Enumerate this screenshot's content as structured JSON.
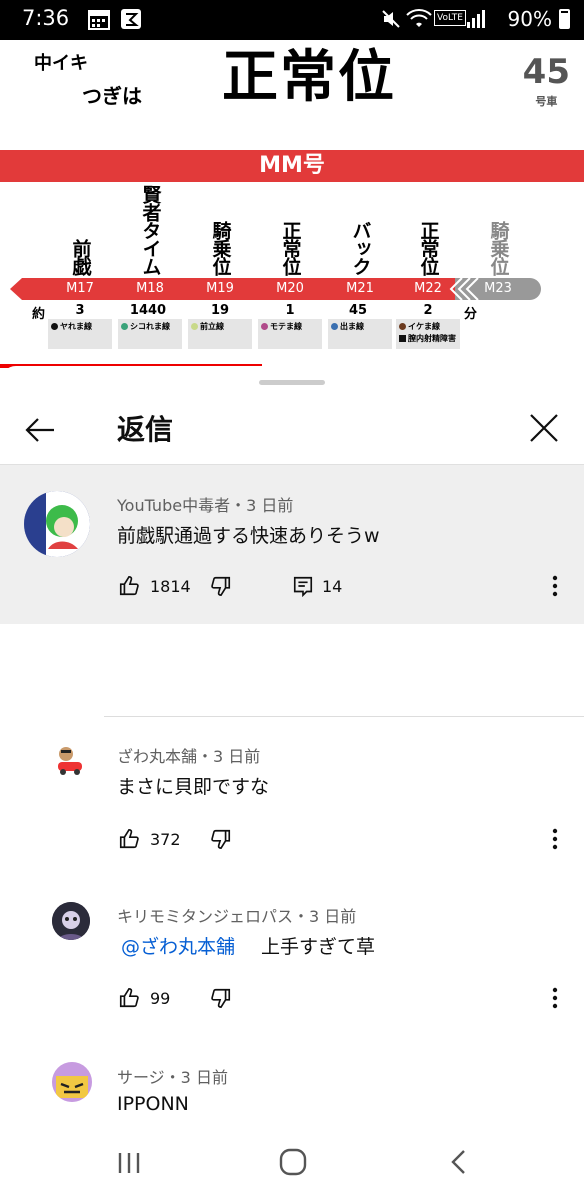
{
  "status_bar": {
    "time": "7:36",
    "battery": "90%",
    "volte": "VoLTE"
  },
  "board": {
    "service_type": "中イキ",
    "next_label": "つぎは",
    "next_station": "正常位",
    "line_name": "MM号",
    "car_number": "45",
    "car_label": "号車",
    "approx_label": "約",
    "minutes_label": "分",
    "stations": [
      {
        "name": "前戯",
        "code": "M17",
        "minutes": "3",
        "line": "ヤれま線",
        "line_color": "#111111",
        "extra": ""
      },
      {
        "name": "賢者タイム",
        "code": "M18",
        "minutes": "1440",
        "line": "シコれま線",
        "line_color": "#3aa37a",
        "extra": ""
      },
      {
        "name": "騎乗位",
        "code": "M19",
        "minutes": "19",
        "line": "前立線",
        "line_color": "#c8d98a",
        "extra": ""
      },
      {
        "name": "正常位",
        "code": "M20",
        "minutes": "1",
        "line": "モテま線",
        "line_color": "#b04a8a",
        "extra": ""
      },
      {
        "name": "バック",
        "code": "M21",
        "minutes": "45",
        "line": "出ま線",
        "line_color": "#3a6fb0",
        "extra": ""
      },
      {
        "name": "正常位",
        "code": "M22",
        "minutes": "2",
        "line": "イケま線",
        "line_color": "#6b3a1e",
        "extra": "膣内射精障害"
      },
      {
        "name": "騎乗位",
        "code": "M23",
        "minutes": "",
        "line": "",
        "line_color": "",
        "extra": ""
      }
    ]
  },
  "replies_panel": {
    "title": "返信"
  },
  "parent_comment": {
    "author": "YouTube中毒者・3 日前",
    "text": "前戯駅通過する快速ありそうw",
    "likes": "1814",
    "replies": "14"
  },
  "replies": [
    {
      "author": "ざわ丸本舗・3 日前",
      "mention": "",
      "text": "まさに貝即ですな",
      "likes": "372"
    },
    {
      "author": "キリモミタンジェロパス・3 日前",
      "mention": "@ざわ丸本舗",
      "text": "上手すぎて草",
      "likes": "99"
    },
    {
      "author": "サージ・3 日前",
      "mention": "",
      "text": "IPPONN",
      "likes": ""
    }
  ]
}
